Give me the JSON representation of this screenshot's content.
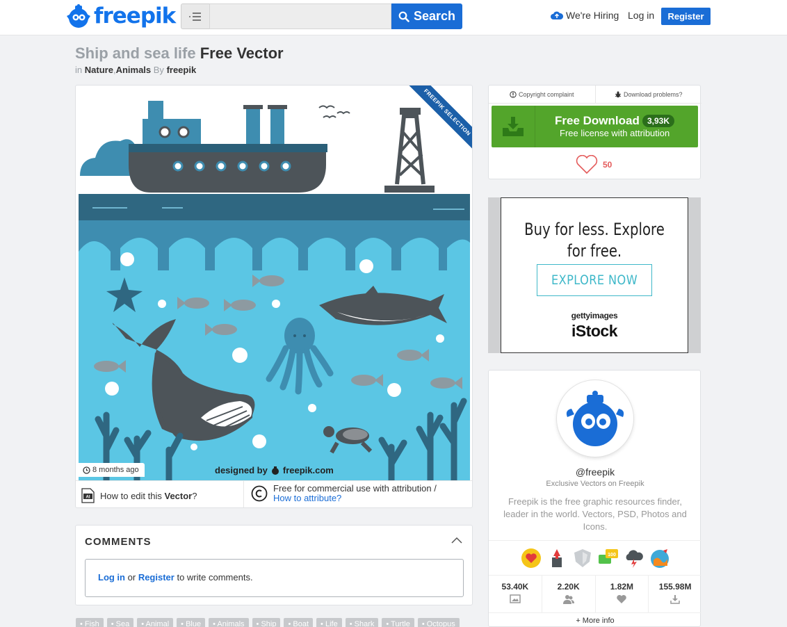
{
  "header": {
    "logo_text": "freepik",
    "search_placeholder": "",
    "search_label": "Search",
    "hiring": "We're Hiring",
    "login": "Log in",
    "register": "Register"
  },
  "title": {
    "grey": "Ship and sea life",
    "dark": "Free Vector"
  },
  "breadcrumb": {
    "in": "in",
    "cat1": "Nature",
    "sep": ",",
    "cat2": "Animals",
    "by": "By",
    "author": "freepik"
  },
  "image": {
    "ribbon": "FREEPIK SELECTION",
    "credit": "designed by",
    "credit_brand": "freepik.com",
    "time_ago": "8 months ago",
    "edit_prefix": "How to edit this",
    "edit_bold": "Vector",
    "edit_suffix": "?",
    "license_line1": "Free for commercial use with attribution /",
    "license_link": "How to attribute?"
  },
  "comments": {
    "title": "COMMENTS",
    "login": "Log in",
    "or": "or",
    "register": "Register",
    "suffix": "to write comments."
  },
  "tags": [
    "Fish",
    "Sea",
    "Animal",
    "Blue",
    "Animals",
    "Ship",
    "Boat",
    "Life",
    "Shark",
    "Turtle",
    "Octopus"
  ],
  "download": {
    "copyright": "Copyright complaint",
    "problems": "Download problems?",
    "title": "Free Download",
    "count": "3,93K",
    "subtitle": "Free license with attribution",
    "likes": "50"
  },
  "ad": {
    "headline_1": "Buy for less. Explore",
    "headline_2": "for free.",
    "cta": "EXPLORE NOW",
    "brand_1": "gettyimages",
    "brand_2": "iStock"
  },
  "profile": {
    "handle": "@freepik",
    "subtitle": "Exclusive Vectors on Freepik",
    "bio": "Freepik is the free graphic resources finder, leader in the world. Vectors, PSD, Photos and Icons.",
    "stats": [
      {
        "value": "53.40K",
        "icon": "image-icon"
      },
      {
        "value": "2.20K",
        "icon": "followers-icon"
      },
      {
        "value": "1.82M",
        "icon": "heart-icon"
      },
      {
        "value": "155.98M",
        "icon": "download-icon"
      }
    ],
    "more_info": "+ More info"
  },
  "colors": {
    "brand_blue": "#1a6dd6",
    "download_green": "#53a52b",
    "ocean": "#5bc6e4",
    "ship_hull": "#4d5459",
    "ship_top": "#3e8db0"
  }
}
